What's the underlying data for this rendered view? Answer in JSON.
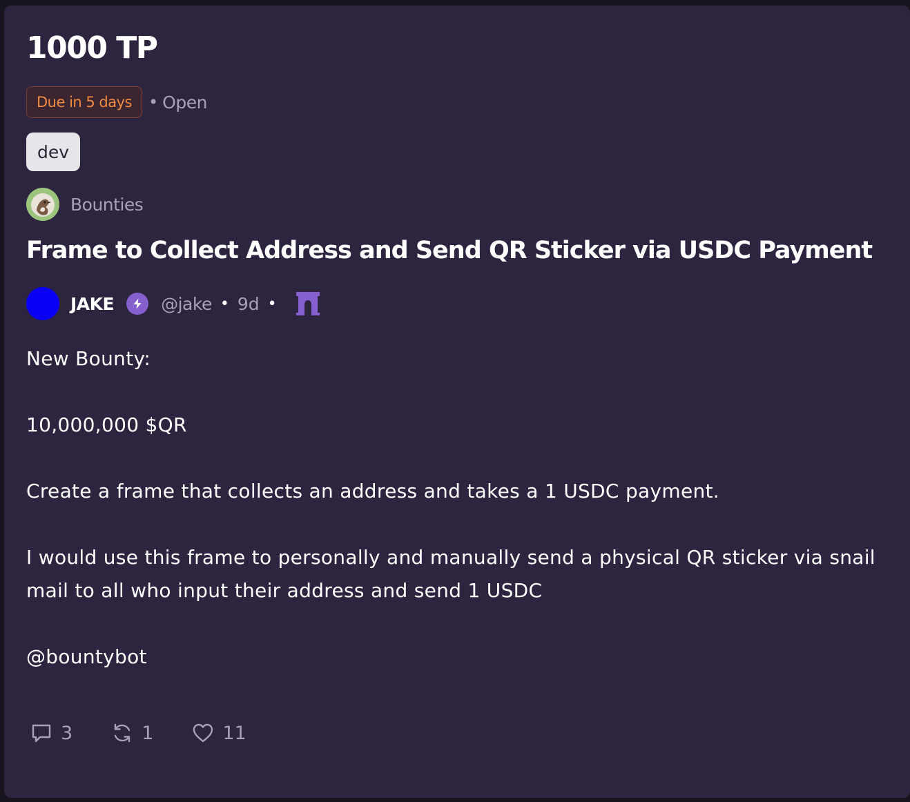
{
  "bounty": {
    "amount": "1000 TP",
    "due_label": "Due in 5 days",
    "separator": "•",
    "status": "Open",
    "tag": "dev"
  },
  "channel": {
    "name": "Bounties",
    "avatar_icon": "bird-avatar-icon"
  },
  "post": {
    "title": "Frame to Collect Address and Send QR Sticker via USDC Payment",
    "author": {
      "display_name": "JAKE",
      "badge_icon": "lightning-badge-icon",
      "handle": "@jake",
      "age": "9d",
      "client_icon": "arch-icon",
      "dot": "•"
    },
    "body": [
      "New Bounty:",
      "10,000,000 $QR",
      "Create a frame that collects an address and takes a 1 USDC payment.",
      "I would use this frame to personally and manually send a physical QR sticker via snail mail to all who input their address and send 1 USDC",
      "@bountybot"
    ]
  },
  "actions": {
    "replies": "3",
    "recasts": "1",
    "likes": "11"
  },
  "colors": {
    "background": "#17141d",
    "card": "#2d2440",
    "due_text": "#f08a40",
    "muted_text": "#a8a0b6",
    "accent_purple": "#8660cf",
    "author_avatar": "#0a00f5"
  }
}
